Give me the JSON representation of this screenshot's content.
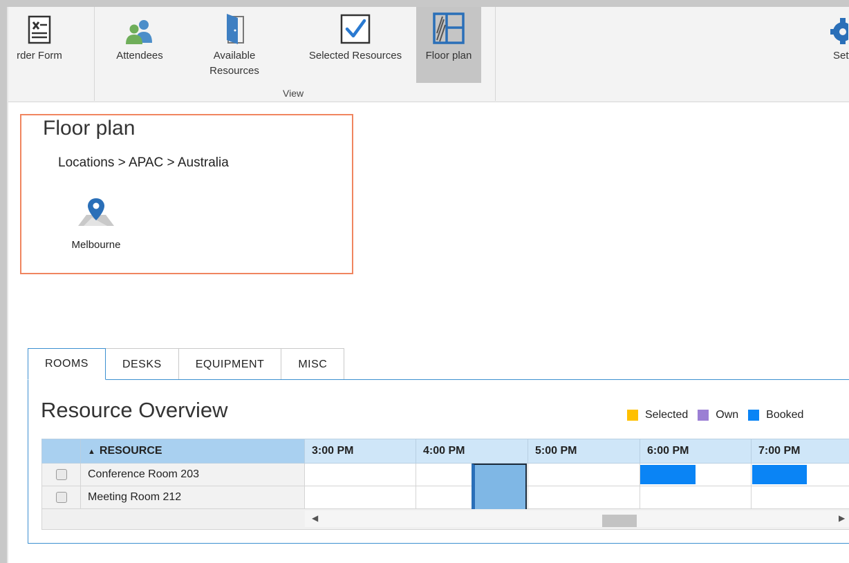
{
  "ribbon": {
    "buttons": [
      {
        "label": "rder Form",
        "icon": "order-form-icon"
      },
      {
        "label": "Attendees",
        "icon": "attendees-icon"
      },
      {
        "label": "Available Resources",
        "icon": "door-icon"
      },
      {
        "label": "Selected Resources",
        "icon": "checkbox-icon"
      },
      {
        "label": "Floor plan",
        "icon": "floor-plan-icon",
        "active": true
      },
      {
        "label": "Setti",
        "icon": "gear-icon"
      }
    ],
    "group_label": "View"
  },
  "floor_plan": {
    "title": "Floor plan",
    "breadcrumb": "Locations > APAC > Australia",
    "location": {
      "label": "Melbourne",
      "icon": "map-pin-icon"
    }
  },
  "tabs": [
    "ROOMS",
    "DESKS",
    "EQUIPMENT",
    "MISC"
  ],
  "active_tab": "ROOMS",
  "overview": {
    "title": "Resource Overview",
    "legend": [
      {
        "label": "Selected",
        "color": "#ffc000"
      },
      {
        "label": "Own",
        "color": "#9b7fd4"
      },
      {
        "label": "Booked",
        "color": "#0a84f5"
      }
    ],
    "grid": {
      "resource_header": "RESOURCE",
      "sort_icon": "sort-ascending-icon",
      "time_columns": [
        "3:00 PM",
        "4:00 PM",
        "5:00 PM",
        "6:00 PM",
        "7:00 PM"
      ],
      "rows": [
        {
          "name": "Conference Room 203",
          "checked": false
        },
        {
          "name": "Meeting Room 212",
          "checked": false
        }
      ]
    }
  }
}
